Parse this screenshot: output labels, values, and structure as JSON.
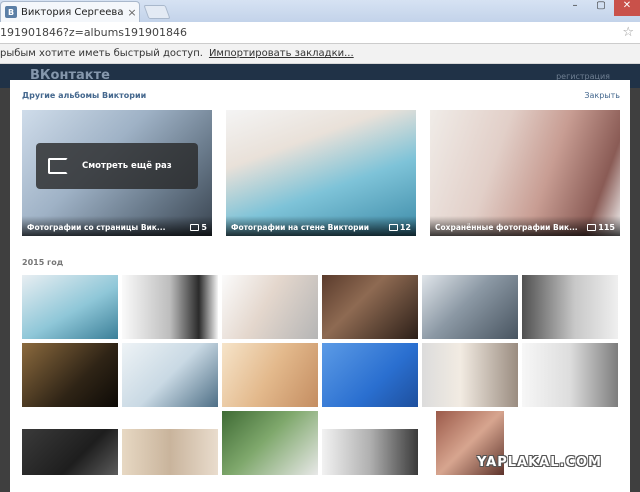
{
  "browser": {
    "tab_title": "Виктория Сергеева | ВКо",
    "tab_favicon": "В",
    "tab_close": "×",
    "url": "191901846?z=albums191901846",
    "bookmark_prompt": "рыбым хотите иметь быстрый доступ.",
    "bookmark_link": "Импортировать закладки..."
  },
  "site": {
    "logo": "ВКонтакте",
    "register": "регистрация"
  },
  "panel": {
    "heading": "Другие альбомы Виктории",
    "close_label": "Закрыть",
    "replay_label": "Смотреть ещё раз",
    "year_label": "2015 год",
    "albums": [
      {
        "title": "Фотографии со страницы Вик...",
        "count": "5"
      },
      {
        "title": "Фотографии на стене Виктории",
        "count": "12"
      },
      {
        "title": "Сохранённые фотографии Вик...",
        "count": "115"
      }
    ]
  },
  "watermark": "YAPLAKAL.COM",
  "colors": {
    "link": "#45688e",
    "header_bg": "#203247"
  }
}
